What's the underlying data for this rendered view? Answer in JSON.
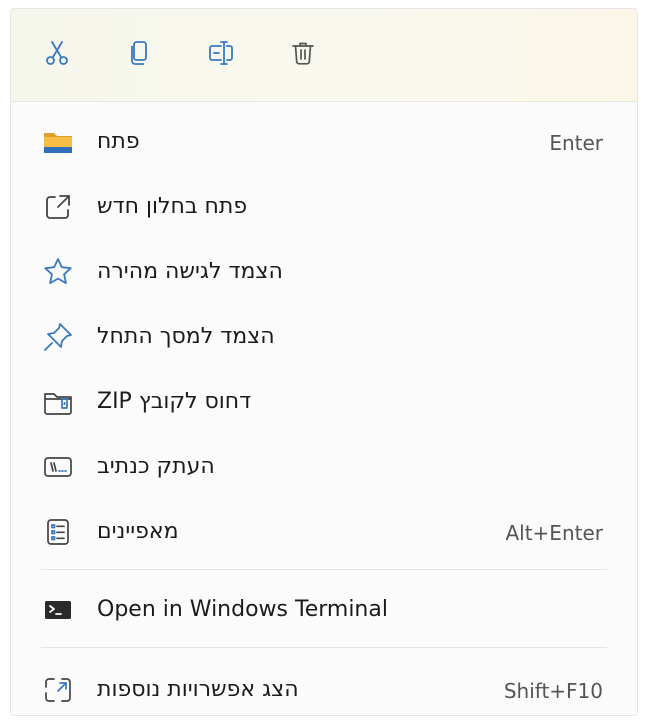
{
  "toolbar": {
    "buttons": [
      {
        "name": "cut-icon"
      },
      {
        "name": "copy-icon"
      },
      {
        "name": "rename-icon"
      },
      {
        "name": "delete-icon"
      }
    ]
  },
  "menu": {
    "items": [
      {
        "label": "פתח",
        "shortcut": "Enter",
        "icon": "folder-icon"
      },
      {
        "label": "פתח בחלון חדש",
        "shortcut": "",
        "icon": "open-new-window-icon"
      },
      {
        "label": "הצמד לגישה מהירה",
        "shortcut": "",
        "icon": "star-icon"
      },
      {
        "label": "הצמד למסך התחל",
        "shortcut": "",
        "icon": "pin-icon"
      },
      {
        "label": "דחוס לקובץ ZIP",
        "shortcut": "",
        "icon": "zip-icon"
      },
      {
        "label": "העתק כנתיב",
        "shortcut": "",
        "icon": "copy-path-icon"
      },
      {
        "label": "מאפיינים",
        "shortcut": "Alt+Enter",
        "icon": "properties-icon"
      }
    ],
    "terminal": {
      "label": "Open in Windows Terminal",
      "icon": "terminal-icon"
    },
    "more": {
      "label": "הצג אפשרויות נוספות",
      "shortcut": "Shift+F10",
      "icon": "more-options-icon"
    }
  },
  "colors": {
    "accent": "#3a78c2",
    "folder_yellow": "#f2b43a",
    "text": "#1b1b1b",
    "shortcut": "#555555"
  }
}
